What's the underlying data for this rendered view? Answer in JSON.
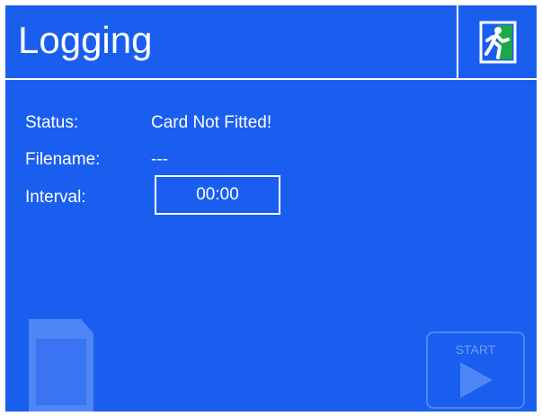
{
  "screen": {
    "title": "Logging",
    "exit_icon": "exit-door-icon"
  },
  "fields": {
    "status_label": "Status:",
    "status_value": "Card Not Fitted!",
    "filename_label": "Filename:",
    "filename_value": "---",
    "interval_label": "Interval:",
    "interval_value": "00:00"
  },
  "controls": {
    "start_label": "START",
    "start_icon": "play-icon",
    "sd_card_icon": "sd-card-icon"
  },
  "colors": {
    "background": "#1a5ef0",
    "text": "#ffffff",
    "disabled": "#4f86f5"
  }
}
